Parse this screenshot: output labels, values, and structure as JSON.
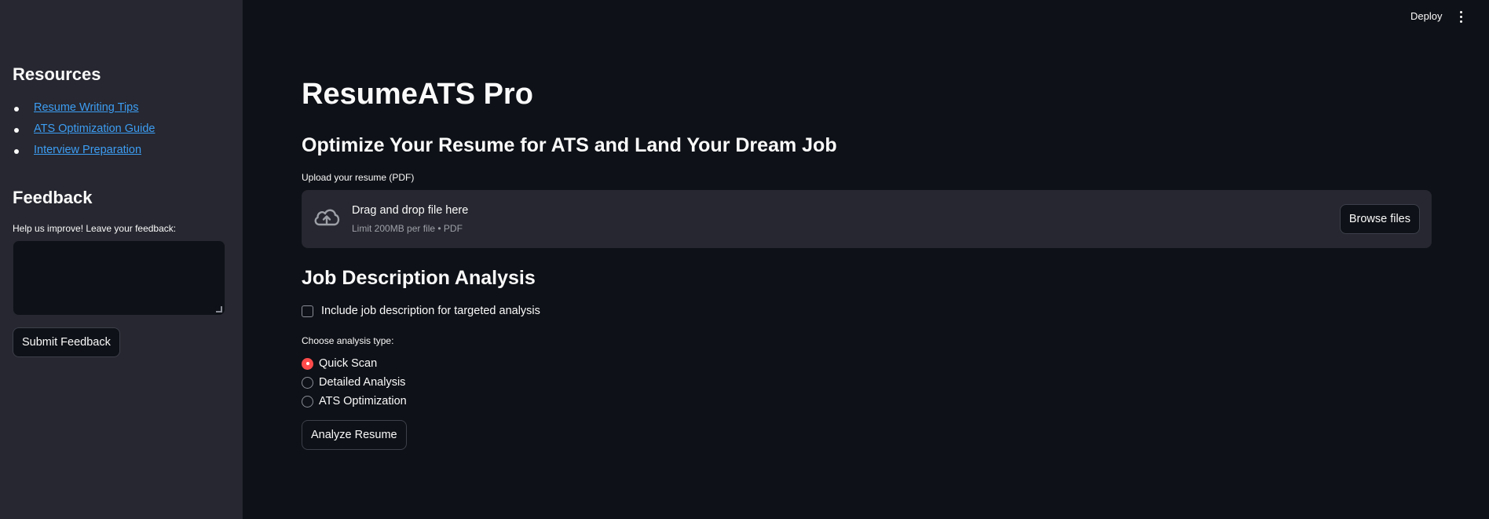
{
  "header": {
    "deploy_label": "Deploy",
    "menu_icon": "kebab-menu-icon"
  },
  "sidebar": {
    "resources_heading": "Resources",
    "links": [
      {
        "label": "Resume Writing Tips"
      },
      {
        "label": "ATS Optimization Guide"
      },
      {
        "label": "Interview Preparation"
      }
    ],
    "feedback_heading": "Feedback",
    "feedback_label": "Help us improve! Leave your feedback:",
    "feedback_value": "",
    "submit_label": "Submit Feedback"
  },
  "main": {
    "title": "ResumeATS Pro",
    "subtitle": "Optimize Your Resume for ATS and Land Your Dream Job",
    "upload": {
      "label": "Upload your resume (PDF)",
      "drop_text": "Drag and drop file here",
      "limit_text": "Limit 200MB per file • PDF",
      "browse_label": "Browse files",
      "icon": "cloud-upload-icon"
    },
    "jd_heading": "Job Description Analysis",
    "jd_checkbox": {
      "label": "Include job description for targeted analysis",
      "checked": false
    },
    "analysis_label": "Choose analysis type:",
    "analysis_options": [
      {
        "label": "Quick Scan",
        "selected": true
      },
      {
        "label": "Detailed Analysis",
        "selected": false
      },
      {
        "label": "ATS Optimization",
        "selected": false
      }
    ],
    "analyze_label": "Analyze Resume"
  },
  "colors": {
    "background": "#0e1117",
    "sidebar": "#262730",
    "link": "#3d9df3",
    "accent": "#ff4b4b"
  }
}
